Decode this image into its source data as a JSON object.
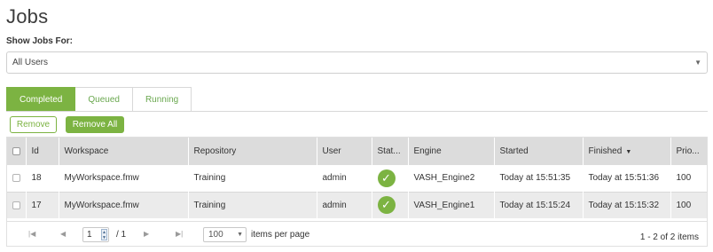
{
  "page": {
    "title": "Jobs"
  },
  "filter": {
    "label": "Show Jobs For:",
    "value": "All Users"
  },
  "tabs": [
    {
      "label": "Completed",
      "active": true
    },
    {
      "label": "Queued",
      "active": false
    },
    {
      "label": "Running",
      "active": false
    }
  ],
  "actions": {
    "remove_label": "Remove",
    "remove_all_label": "Remove All"
  },
  "grid": {
    "columns": [
      "Id",
      "Workspace",
      "Repository",
      "User",
      "Stat...",
      "Engine",
      "Started",
      "Finished",
      "Prio..."
    ],
    "sort": {
      "column": "Finished",
      "direction": "descending"
    },
    "rows": [
      {
        "id": "18",
        "workspace": "MyWorkspace.fmw",
        "repository": "Training",
        "user": "admin",
        "status": "success",
        "engine": "VASH_Engine2",
        "started": "Today at 15:51:35",
        "finished": "Today at 15:51:36",
        "priority": "100"
      },
      {
        "id": "17",
        "workspace": "MyWorkspace.fmw",
        "repository": "Training",
        "user": "admin",
        "status": "success",
        "engine": "VASH_Engine1",
        "started": "Today at 15:15:24",
        "finished": "Today at 15:15:32",
        "priority": "100"
      }
    ]
  },
  "pager": {
    "page": "1",
    "of_label": "/ 1",
    "page_size": "100",
    "page_size_label": "items per page",
    "info": "1 - 2 of 2 items"
  },
  "colors": {
    "accent": "#7cb342",
    "header_bg": "#dcdcdc",
    "alt_row": "#ebebeb"
  },
  "icons": {
    "status": "check-circle-icon",
    "sort": "triangle-down-icon",
    "first": "first-page-icon",
    "prev": "prev-page-icon",
    "next": "next-page-icon",
    "last": "last-page-icon"
  }
}
